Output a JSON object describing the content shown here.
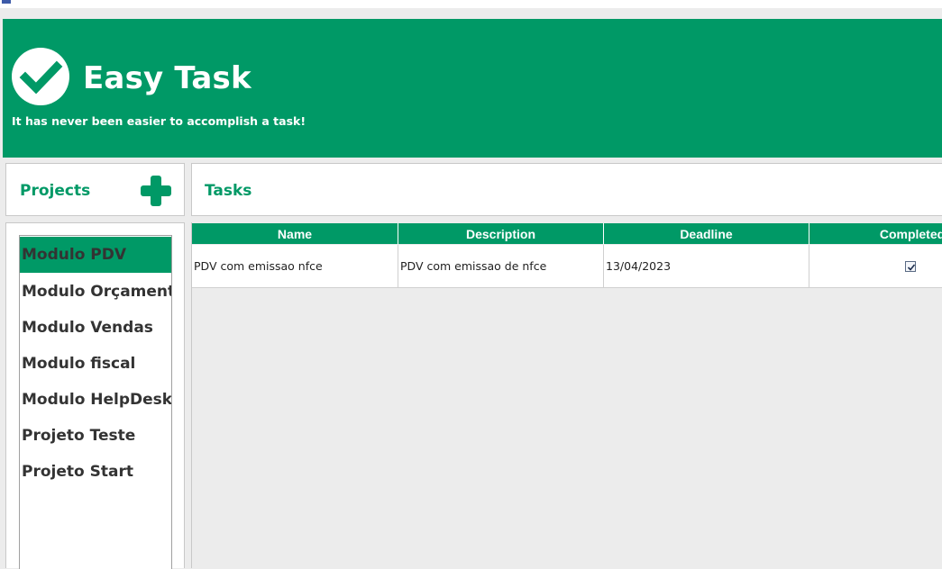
{
  "app": {
    "title": "Easy Task",
    "tagline": "It has never been easier to accomplish a task!",
    "logo_icon": "check-circle-icon"
  },
  "colors": {
    "accent": "#009966",
    "background": "#ececec",
    "text": "#333333"
  },
  "projects": {
    "header": "Projects",
    "add_icon": "plus-icon",
    "items": [
      {
        "label": "Modulo PDV",
        "selected": true
      },
      {
        "label": "Modulo Orçamento",
        "selected": false
      },
      {
        "label": "Modulo Vendas",
        "selected": false
      },
      {
        "label": "Modulo fiscal",
        "selected": false
      },
      {
        "label": "Modulo HelpDesk",
        "selected": false
      },
      {
        "label": "Projeto Teste",
        "selected": false
      },
      {
        "label": "Projeto Start",
        "selected": false
      }
    ]
  },
  "tasks": {
    "header": "Tasks",
    "columns": [
      "Name",
      "Description",
      "Deadline",
      "Completed"
    ],
    "rows": [
      {
        "name": "PDV com emissao nfce",
        "description": "PDV com emissao de nfce",
        "deadline": "13/04/2023",
        "completed": true
      }
    ]
  }
}
